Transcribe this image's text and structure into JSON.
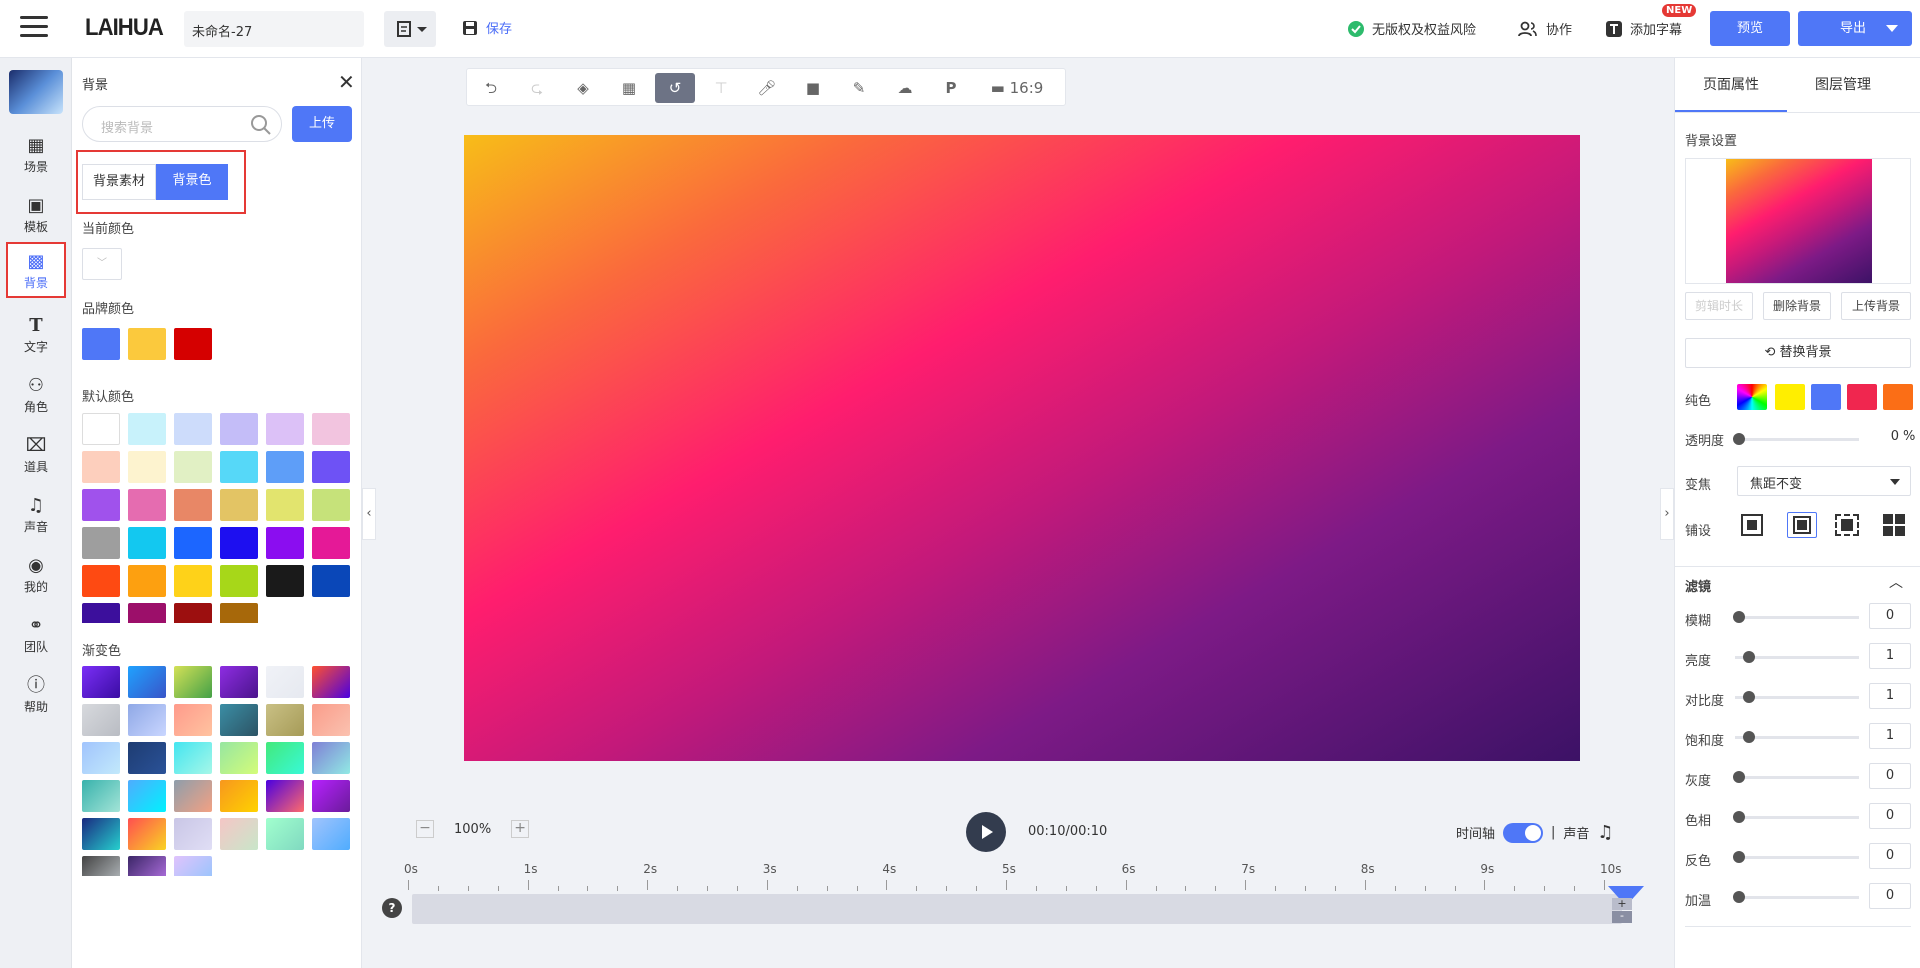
{
  "header": {
    "logo": "LAIHUA",
    "filename": "未命名-27",
    "save": "保存",
    "risk": "无版权及权益风险",
    "collab": "协作",
    "subtitle": "添加字幕",
    "new_badge": "NEW",
    "preview": "预览",
    "export": "导出"
  },
  "nav": {
    "items": [
      {
        "label": "场景"
      },
      {
        "label": "模板"
      },
      {
        "label": "背景"
      },
      {
        "label": "文字"
      },
      {
        "label": "角色"
      },
      {
        "label": "道具"
      },
      {
        "label": "声音"
      },
      {
        "label": "我的"
      },
      {
        "label": "团队"
      },
      {
        "label": "帮助"
      }
    ]
  },
  "panel": {
    "title": "背景",
    "search_placeholder": "搜索背景",
    "upload": "上传",
    "tab_material": "背景素材",
    "tab_color": "背景色",
    "current_color": "当前颜色",
    "brand_color": "品牌颜色",
    "default_color": "默认颜色",
    "gradient": "渐变色"
  },
  "brand_colors": [
    "#4f77f7",
    "#fbc93d",
    "#d50000"
  ],
  "default_colors": [
    "#ffffff",
    "#c8f2fb",
    "#cddcfb",
    "#c4bdf8",
    "#dcc1f7",
    "#f2c4df",
    "#fdcfbd",
    "#fdf3cf",
    "#e1f0c4",
    "#56d8f8",
    "#5e9ef8",
    "#6e52f5",
    "#a052ec",
    "#e56cb0",
    "#e88766",
    "#e3c464",
    "#e2e46e",
    "#c6e27a",
    "#9e9e9e",
    "#13c8f0",
    "#1c66ff",
    "#1d0ff0",
    "#8b0df0",
    "#e51997",
    "#fe4a12",
    "#fda010",
    "#fed219",
    "#a7d719",
    "#1a1a1a",
    "#0a47b8",
    "#3c0f9c",
    "#9c0f6a",
    "#9c0f0f",
    "#a7680a"
  ],
  "gradients": [
    [
      "#7b2ff7",
      "#3a0ca3"
    ],
    [
      "#1fa2ff",
      "#3954c8"
    ],
    [
      "#d4e157",
      "#43a047"
    ],
    [
      "#8e2de2",
      "#4a148c"
    ],
    [
      "#f0f2f7",
      "#e6e9f0"
    ],
    [
      "#ff512f",
      "#4a00e0"
    ],
    [
      "#d7d9dd",
      "#b9bcc3"
    ],
    [
      "#8fa8e6",
      "#c9d6ff"
    ],
    [
      "#ff9a8b",
      "#ffc3a0"
    ],
    [
      "#3b8ea5",
      "#2c5364"
    ],
    [
      "#c9c085",
      "#a69b57"
    ],
    [
      "#f99c8a",
      "#fbc2b0"
    ],
    [
      "#a1c4fd",
      "#c2e9fb"
    ],
    [
      "#1e3c72",
      "#2a5298"
    ],
    [
      "#43e5f0",
      "#a6f7e8"
    ],
    [
      "#96e6a1",
      "#d4fc79"
    ],
    [
      "#43e97b",
      "#38f9d7"
    ],
    [
      "#7f7fd5",
      "#91eae4"
    ],
    [
      "#38b2ac",
      "#a3e4d7"
    ],
    [
      "#4facfe",
      "#00f2fe"
    ],
    [
      "#8e9eab",
      "#f3a183"
    ],
    [
      "#f7971e",
      "#ffd200"
    ],
    [
      "#4a00e0",
      "#ff6b6b"
    ],
    [
      "#b721ff",
      "#6a1b9a"
    ],
    [
      "#1a2980",
      "#26d0ce"
    ],
    [
      "#ff4e50",
      "#f9d423"
    ],
    [
      "#c9c6e6",
      "#e0def5"
    ],
    [
      "#f5c6c6",
      "#c8e6c9"
    ],
    [
      "#a1ffce",
      "#80d9c0"
    ],
    [
      "#a1c4fd",
      "#4facfe"
    ],
    [
      "#434343",
      "#bdc3c7"
    ],
    [
      "#3b2667",
      "#bc78ec"
    ],
    [
      "#e0c3fc",
      "#8ec5fc"
    ]
  ],
  "toolbar": {
    "ratio": "16:9"
  },
  "playback": {
    "zoom": "100%",
    "time": "00:10/00:10",
    "timeline_label": "时间轴",
    "sep": "|",
    "sound_label": "声音",
    "help": "?",
    "ticks": [
      "0s",
      "1s",
      "2s",
      "3s",
      "4s",
      "5s",
      "6s",
      "7s",
      "8s",
      "9s",
      "10s"
    ],
    "plus": "+",
    "minus": "-"
  },
  "right": {
    "tab_page": "页面属性",
    "tab_layers": "图层管理",
    "bg_settings": "背景设置",
    "btn_edit": "剪辑时长",
    "btn_delete": "删除背景",
    "btn_upload": "上传背景",
    "btn_replace": "替换背景",
    "pure": "纯色",
    "opacity": "透明度",
    "opacity_val": "0",
    "pct": "%",
    "zoom_label": "变焦",
    "zoom_val": "焦距不变",
    "tile": "铺设",
    "filter": "滤镜",
    "solid_colors": [
      "#ffee00",
      "#4f77f7",
      "#f0264f",
      "#fb6e16"
    ],
    "filters": [
      {
        "label": "模糊",
        "value": "0",
        "level": 0
      },
      {
        "label": "亮度",
        "value": "1",
        "level": 0.08
      },
      {
        "label": "对比度",
        "value": "1",
        "level": 0.08
      },
      {
        "label": "饱和度",
        "value": "1",
        "level": 0.08
      },
      {
        "label": "灰度",
        "value": "0",
        "level": 0
      },
      {
        "label": "色相",
        "value": "0",
        "level": 0
      },
      {
        "label": "反色",
        "value": "0",
        "level": 0
      },
      {
        "label": "加温",
        "value": "0",
        "level": 0
      }
    ]
  }
}
